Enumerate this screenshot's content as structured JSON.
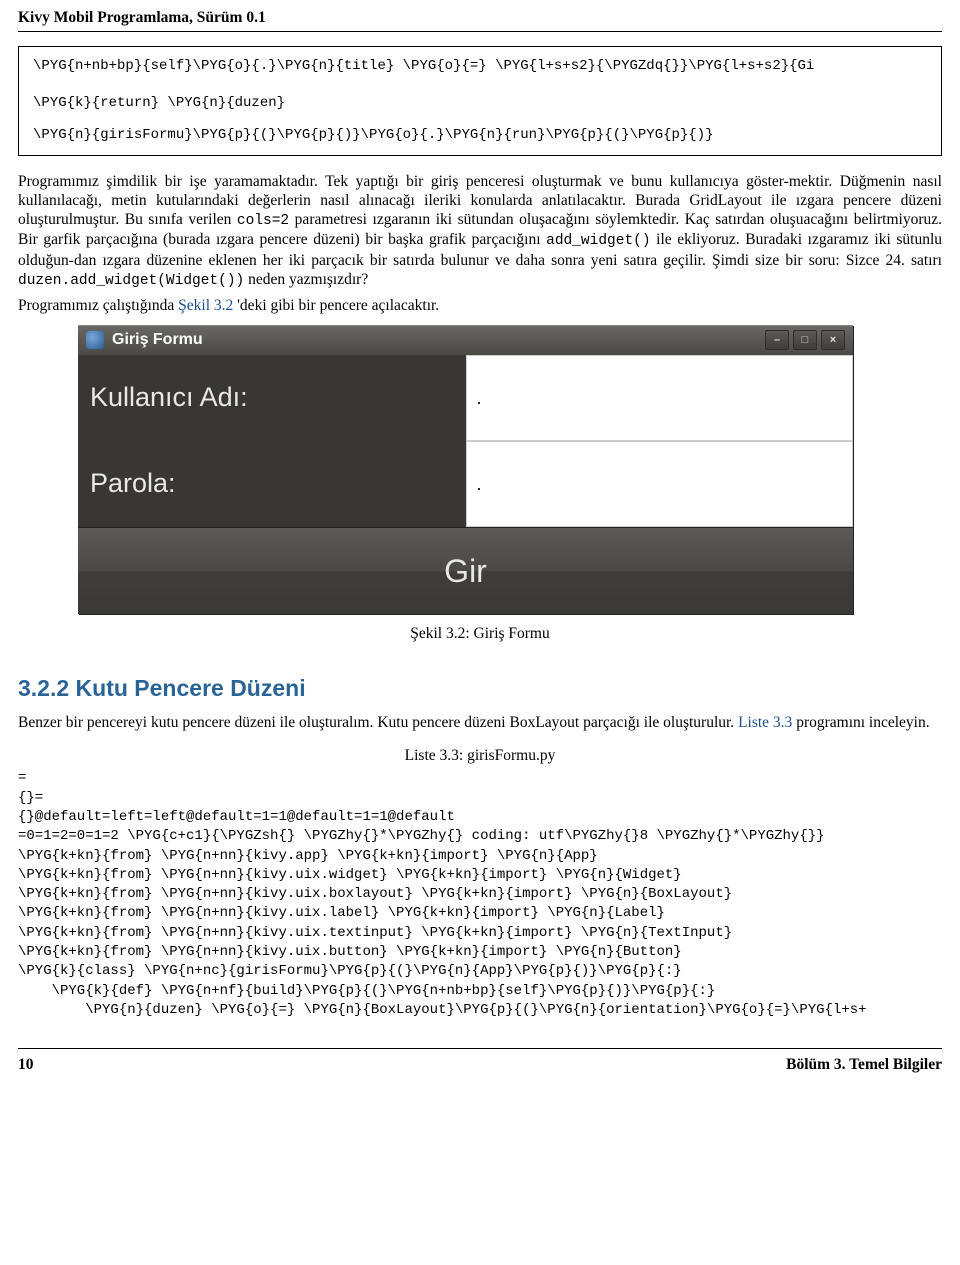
{
  "header": {
    "title": "Kivy Mobil Programlama, Sürüm 0.1"
  },
  "code_box": {
    "line1": "   \\PYG{n+nb+bp}{self}\\PYG{o}{.}\\PYG{n}{title} \\PYG{o}{=} \\PYG{l+s+s2}{\\PYGZdq{}}\\PYG{l+s+s2}{Gi",
    "line2": "   \\PYG{k}{return} \\PYG{n}{duzen}",
    "line3": "\\PYG{n}{girisFormu}\\PYG{p}{(}\\PYG{p}{)}\\PYG{o}{.}\\PYG{n}{run}\\PYG{p}{(}\\PYG{p}{)}"
  },
  "para1_prefix": "Programımız şimdilik bir işe yaramamaktadır. Tek yaptığı bir giriş penceresi oluşturmak ve bunu kullanıcıya göster-mektir. Düğmenin nasıl kullanılacağı, metin kutularındaki değerlerin nasıl alınacağı ileriki konularda anlatılacaktır. Burada GridLayout ile ızgara pencere düzeni oluşturulmuştur. Bu sınıfa verilen ",
  "para1_code1": "cols=2",
  "para1_mid": " parametresi ızgaranın iki sütundan oluşacağını söylemktedir. Kaç satırdan oluşuacağını belirtmiyoruz. Bir garfik parçacığına (burada ızgara pencere düzeni) bir başka grafik parçacığını ",
  "para1_code2": "add_widget()",
  "para1_mid2": " ile ekliyoruz. Buradaki ızgaramız iki sütunlu olduğun-dan ızgara düzenine eklenen her iki parçacık bir satırda bulunur ve daha sonra yeni satıra geçilir. Şimdi size bir soru: Sizce 24. satırı ",
  "para1_code3": "duzen.add_widget(Widget())",
  "para1_suffix": " neden yazmışızdır?",
  "para2_prefix": "Programımız çalıştığında ",
  "para2_link": "Şekil 3.2",
  "para2_suffix": " 'deki gibi bir pencere açılacaktır.",
  "window": {
    "title": "Giriş Formu",
    "label_user": "Kullanıcı Adı:",
    "label_pass": "Parola:",
    "button": "Gir",
    "input_user": ".",
    "input_pass": "."
  },
  "figure_caption": "Şekil 3.2: Giriş Formu",
  "section_title": "3.2.2 Kutu Pencere Düzeni",
  "para3_prefix": "Benzer bir pencereyi kutu pencere düzeni ile oluşturalım. Kutu pencere düzeni BoxLayout parçacığı ile oluşturulur. ",
  "para3_link": "Liste 3.3",
  "para3_suffix": " programını inceleyin.",
  "liste_caption": "Liste 3.3: girisFormu.py",
  "code2": {
    "l0": "=",
    "l1": "{}=",
    "l2": "{}@default=left=left@default=1=1@default=1=1@default",
    "l3": "=0=1=2=0=1=2 \\PYG{c+c1}{\\PYGZsh{} \\PYGZhy{}*\\PYGZhy{} coding: utf\\PYGZhy{}8 \\PYGZhy{}*\\PYGZhy{}}",
    "l4": "\\PYG{k+kn}{from} \\PYG{n+nn}{kivy.app} \\PYG{k+kn}{import} \\PYG{n}{App}",
    "l5": "\\PYG{k+kn}{from} \\PYG{n+nn}{kivy.uix.widget} \\PYG{k+kn}{import} \\PYG{n}{Widget}",
    "l6": "\\PYG{k+kn}{from} \\PYG{n+nn}{kivy.uix.boxlayout} \\PYG{k+kn}{import} \\PYG{n}{BoxLayout}",
    "l7": "\\PYG{k+kn}{from} \\PYG{n+nn}{kivy.uix.label} \\PYG{k+kn}{import} \\PYG{n}{Label}",
    "l8": "\\PYG{k+kn}{from} \\PYG{n+nn}{kivy.uix.textinput} \\PYG{k+kn}{import} \\PYG{n}{TextInput}",
    "l9": "\\PYG{k+kn}{from} \\PYG{n+nn}{kivy.uix.button} \\PYG{k+kn}{import} \\PYG{n}{Button}",
    "l10": "",
    "l11": "\\PYG{k}{class} \\PYG{n+nc}{girisFormu}\\PYG{p}{(}\\PYG{n}{App}\\PYG{p}{)}\\PYG{p}{:}",
    "l12": "",
    "l13": "    \\PYG{k}{def} \\PYG{n+nf}{build}\\PYG{p}{(}\\PYG{n+nb+bp}{self}\\PYG{p}{)}\\PYG{p}{:}",
    "l14": "",
    "l15": "        \\PYG{n}{duzen} \\PYG{o}{=} \\PYG{n}{BoxLayout}\\PYG{p}{(}\\PYG{n}{orientation}\\PYG{o}{=}\\PYG{l+s+"
  },
  "footer": {
    "page": "10",
    "chapter": "Bölüm 3. Temel Bilgiler"
  }
}
